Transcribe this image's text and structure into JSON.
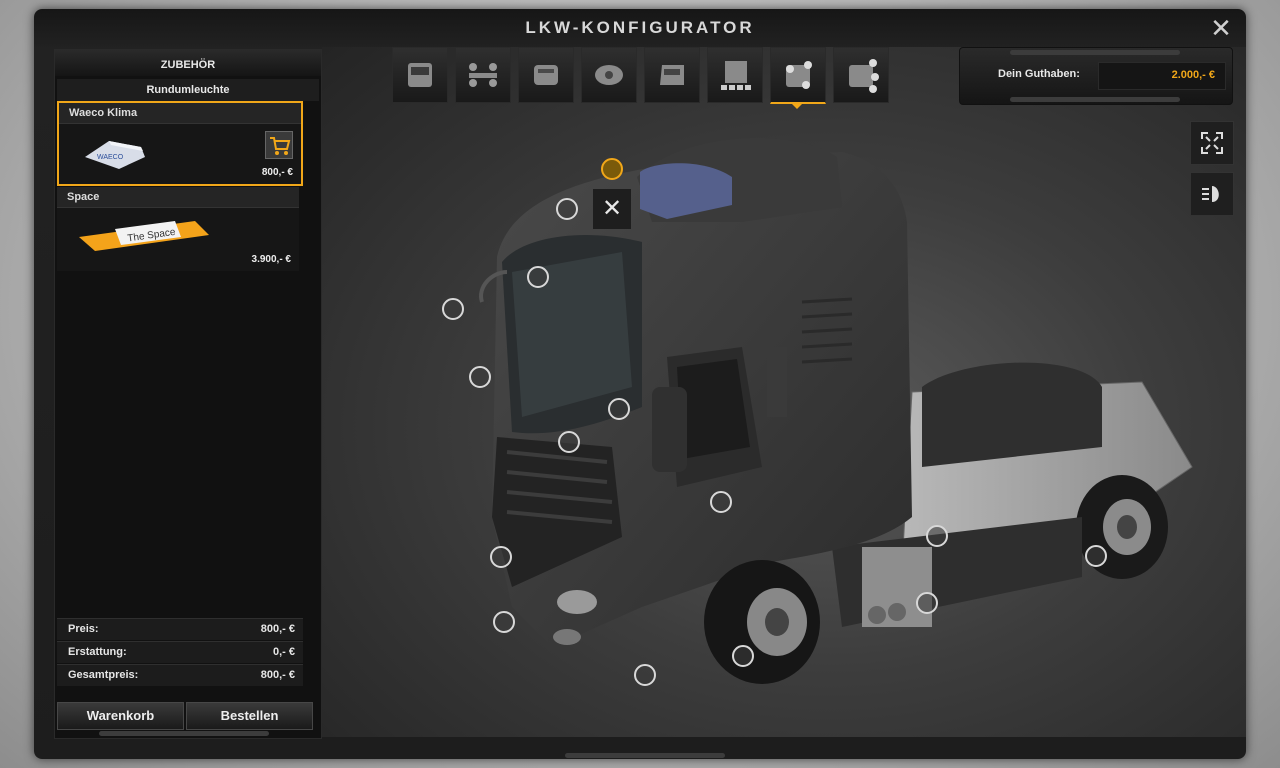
{
  "window": {
    "title": "LKW-KONFIGURATOR"
  },
  "panel": {
    "header": "ZUBEHÖR",
    "subheader": "Rundumleuchte",
    "items": [
      {
        "name": "Waeco Klima",
        "price": "800,- €",
        "selected": true
      },
      {
        "name": "Space",
        "price": "3.900,- €",
        "selected": false
      }
    ],
    "item_image_text": "The Space",
    "totals": [
      {
        "label": "Preis:",
        "value": "800,- €"
      },
      {
        "label": "Erstattung:",
        "value": "0,- €"
      },
      {
        "label": "Gesamtpreis:",
        "value": "800,- €"
      }
    ],
    "cart_button": "Warenkorb",
    "order_button": "Bestellen"
  },
  "balance": {
    "label": "Dein Guthaben:",
    "value": "2.000,- €"
  },
  "colors": {
    "accent": "#f1a719",
    "panel": "#111111",
    "truck": "#3b3b3b"
  },
  "toolbar": {
    "icons": [
      "cab-icon",
      "chassis-icon",
      "engine-icon",
      "transmission-icon",
      "interior-icon",
      "body-icon",
      "accessories-icon",
      "lights-icon"
    ],
    "active_index": 6
  }
}
